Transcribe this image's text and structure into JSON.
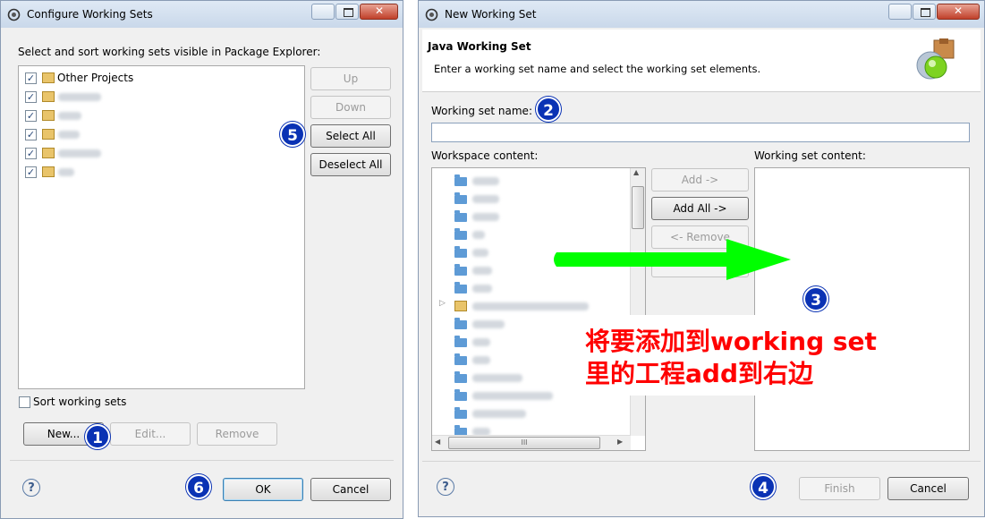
{
  "left_dialog": {
    "title": "Configure Working Sets",
    "instruction": "Select and sort working sets visible in Package Explorer:",
    "items": [
      {
        "label": "Other Projects",
        "checked": true
      },
      {
        "label": "",
        "checked": true
      },
      {
        "label": "",
        "checked": true
      },
      {
        "label": "",
        "checked": true
      },
      {
        "label": "",
        "checked": true
      },
      {
        "label": "",
        "checked": true
      }
    ],
    "buttons": {
      "up": "Up",
      "down": "Down",
      "select_all": "Select All",
      "deselect_all": "Deselect All",
      "new": "New...",
      "edit": "Edit...",
      "remove": "Remove",
      "ok": "OK",
      "cancel": "Cancel"
    },
    "sort_label": "Sort working sets",
    "help": "?"
  },
  "right_dialog": {
    "title": "New Working Set",
    "header_title": "Java Working Set",
    "header_desc": "Enter a working set name and select the working set elements.",
    "name_label": "Working set name:",
    "name_value": "",
    "workspace_label": "Workspace content:",
    "working_content_label": "Working set content:",
    "buttons": {
      "add": "Add ->",
      "add_all": "Add All ->",
      "remove": "<- Remove",
      "finish": "Finish",
      "cancel": "Cancel"
    },
    "scroll_mid": "III",
    "help": "?"
  },
  "annotations": {
    "b1": "1",
    "b2": "2",
    "b3": "3",
    "b4": "4",
    "b5": "5",
    "b6": "6",
    "note_line1": "将要添加到working set",
    "note_line2": "里的工程add到右边",
    "note_color": "#ff0000",
    "arrow_color": "#00ff00",
    "badge_color": "#0a32b4"
  }
}
